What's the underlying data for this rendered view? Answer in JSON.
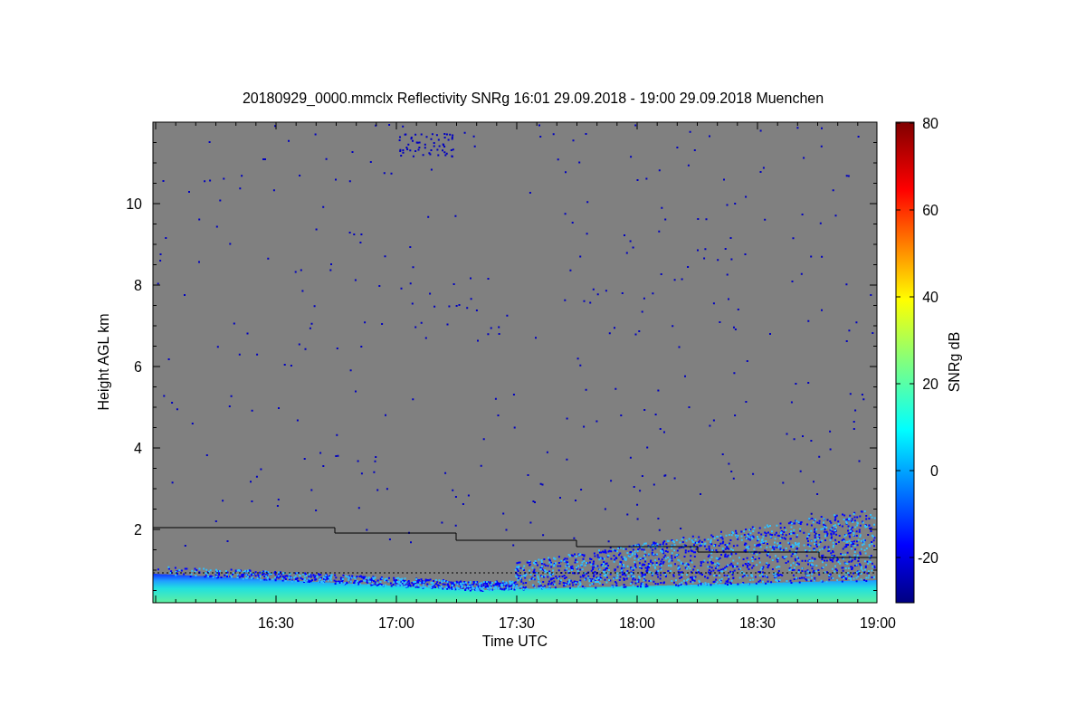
{
  "title": "20180929_0000.mmclx Reflectivity SNRg   16:01 29.09.2018 - 19:00 29.09.2018 Muenchen",
  "y_axis": {
    "label": "Height AGL km",
    "ticks": [
      "10",
      "8",
      "6",
      "4",
      "2"
    ]
  },
  "x_axis": {
    "label": "Time UTC",
    "ticks": [
      "16:30",
      "17:00",
      "17:30",
      "18:00",
      "18:30",
      "19:00"
    ]
  },
  "colorbar": {
    "label": "SNRg dB",
    "ticks": [
      "80",
      "60",
      "40",
      "20",
      "0",
      "-20"
    ]
  }
}
